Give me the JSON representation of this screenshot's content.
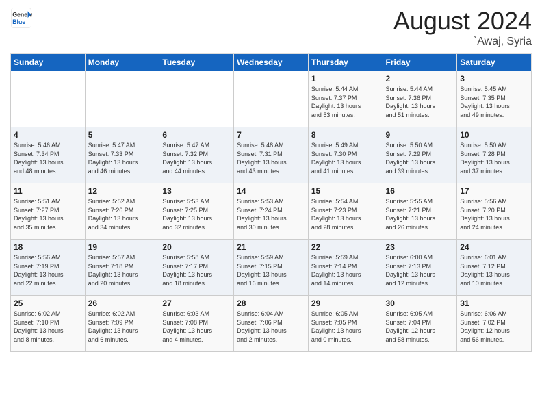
{
  "header": {
    "logo_general": "General",
    "logo_blue": "Blue",
    "month_year": "August 2024",
    "location": "`Awaj, Syria"
  },
  "calendar": {
    "days_of_week": [
      "Sunday",
      "Monday",
      "Tuesday",
      "Wednesday",
      "Thursday",
      "Friday",
      "Saturday"
    ],
    "weeks": [
      [
        {
          "day": "",
          "info": ""
        },
        {
          "day": "",
          "info": ""
        },
        {
          "day": "",
          "info": ""
        },
        {
          "day": "",
          "info": ""
        },
        {
          "day": "1",
          "info": "Sunrise: 5:44 AM\nSunset: 7:37 PM\nDaylight: 13 hours\nand 53 minutes."
        },
        {
          "day": "2",
          "info": "Sunrise: 5:44 AM\nSunset: 7:36 PM\nDaylight: 13 hours\nand 51 minutes."
        },
        {
          "day": "3",
          "info": "Sunrise: 5:45 AM\nSunset: 7:35 PM\nDaylight: 13 hours\nand 49 minutes."
        }
      ],
      [
        {
          "day": "4",
          "info": "Sunrise: 5:46 AM\nSunset: 7:34 PM\nDaylight: 13 hours\nand 48 minutes."
        },
        {
          "day": "5",
          "info": "Sunrise: 5:47 AM\nSunset: 7:33 PM\nDaylight: 13 hours\nand 46 minutes."
        },
        {
          "day": "6",
          "info": "Sunrise: 5:47 AM\nSunset: 7:32 PM\nDaylight: 13 hours\nand 44 minutes."
        },
        {
          "day": "7",
          "info": "Sunrise: 5:48 AM\nSunset: 7:31 PM\nDaylight: 13 hours\nand 43 minutes."
        },
        {
          "day": "8",
          "info": "Sunrise: 5:49 AM\nSunset: 7:30 PM\nDaylight: 13 hours\nand 41 minutes."
        },
        {
          "day": "9",
          "info": "Sunrise: 5:50 AM\nSunset: 7:29 PM\nDaylight: 13 hours\nand 39 minutes."
        },
        {
          "day": "10",
          "info": "Sunrise: 5:50 AM\nSunset: 7:28 PM\nDaylight: 13 hours\nand 37 minutes."
        }
      ],
      [
        {
          "day": "11",
          "info": "Sunrise: 5:51 AM\nSunset: 7:27 PM\nDaylight: 13 hours\nand 35 minutes."
        },
        {
          "day": "12",
          "info": "Sunrise: 5:52 AM\nSunset: 7:26 PM\nDaylight: 13 hours\nand 34 minutes."
        },
        {
          "day": "13",
          "info": "Sunrise: 5:53 AM\nSunset: 7:25 PM\nDaylight: 13 hours\nand 32 minutes."
        },
        {
          "day": "14",
          "info": "Sunrise: 5:53 AM\nSunset: 7:24 PM\nDaylight: 13 hours\nand 30 minutes."
        },
        {
          "day": "15",
          "info": "Sunrise: 5:54 AM\nSunset: 7:23 PM\nDaylight: 13 hours\nand 28 minutes."
        },
        {
          "day": "16",
          "info": "Sunrise: 5:55 AM\nSunset: 7:21 PM\nDaylight: 13 hours\nand 26 minutes."
        },
        {
          "day": "17",
          "info": "Sunrise: 5:56 AM\nSunset: 7:20 PM\nDaylight: 13 hours\nand 24 minutes."
        }
      ],
      [
        {
          "day": "18",
          "info": "Sunrise: 5:56 AM\nSunset: 7:19 PM\nDaylight: 13 hours\nand 22 minutes."
        },
        {
          "day": "19",
          "info": "Sunrise: 5:57 AM\nSunset: 7:18 PM\nDaylight: 13 hours\nand 20 minutes."
        },
        {
          "day": "20",
          "info": "Sunrise: 5:58 AM\nSunset: 7:17 PM\nDaylight: 13 hours\nand 18 minutes."
        },
        {
          "day": "21",
          "info": "Sunrise: 5:59 AM\nSunset: 7:15 PM\nDaylight: 13 hours\nand 16 minutes."
        },
        {
          "day": "22",
          "info": "Sunrise: 5:59 AM\nSunset: 7:14 PM\nDaylight: 13 hours\nand 14 minutes."
        },
        {
          "day": "23",
          "info": "Sunrise: 6:00 AM\nSunset: 7:13 PM\nDaylight: 13 hours\nand 12 minutes."
        },
        {
          "day": "24",
          "info": "Sunrise: 6:01 AM\nSunset: 7:12 PM\nDaylight: 13 hours\nand 10 minutes."
        }
      ],
      [
        {
          "day": "25",
          "info": "Sunrise: 6:02 AM\nSunset: 7:10 PM\nDaylight: 13 hours\nand 8 minutes."
        },
        {
          "day": "26",
          "info": "Sunrise: 6:02 AM\nSunset: 7:09 PM\nDaylight: 13 hours\nand 6 minutes."
        },
        {
          "day": "27",
          "info": "Sunrise: 6:03 AM\nSunset: 7:08 PM\nDaylight: 13 hours\nand 4 minutes."
        },
        {
          "day": "28",
          "info": "Sunrise: 6:04 AM\nSunset: 7:06 PM\nDaylight: 13 hours\nand 2 minutes."
        },
        {
          "day": "29",
          "info": "Sunrise: 6:05 AM\nSunset: 7:05 PM\nDaylight: 13 hours\nand 0 minutes."
        },
        {
          "day": "30",
          "info": "Sunrise: 6:05 AM\nSunset: 7:04 PM\nDaylight: 12 hours\nand 58 minutes."
        },
        {
          "day": "31",
          "info": "Sunrise: 6:06 AM\nSunset: 7:02 PM\nDaylight: 12 hours\nand 56 minutes."
        }
      ]
    ]
  }
}
